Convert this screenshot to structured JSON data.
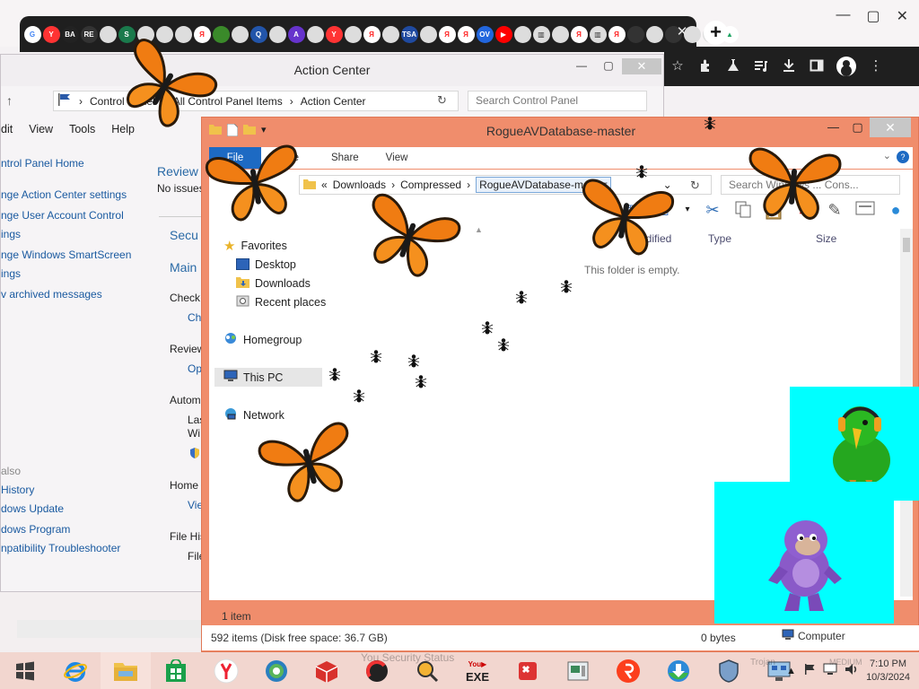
{
  "browser": {
    "favicons": [
      {
        "name": "google",
        "letter": "G",
        "color": "#ffffff",
        "fg": "#4285f4"
      },
      {
        "name": "yandex",
        "letter": "Y",
        "color": "#ff3333",
        "fg": "#ffffff"
      },
      {
        "name": "ba",
        "letter": "BA",
        "color": "#222222",
        "fg": "#ffffff"
      },
      {
        "name": "re",
        "letter": "RE",
        "color": "#333333",
        "fg": "#ffffff"
      },
      {
        "name": "globe",
        "letter": "",
        "color": "#dddddd",
        "fg": "#333"
      },
      {
        "name": "s",
        "letter": "S",
        "color": "#1a7a4c",
        "fg": "#ffffff"
      },
      {
        "name": "globe",
        "letter": "",
        "color": "#dddddd",
        "fg": "#333"
      },
      {
        "name": "globe",
        "letter": "",
        "color": "#dddddd",
        "fg": "#333"
      },
      {
        "name": "globe",
        "letter": "",
        "color": "#dddddd",
        "fg": "#333"
      },
      {
        "name": "ya",
        "letter": "Я",
        "color": "#ffffff",
        "fg": "#ff2222"
      },
      {
        "name": "leaf",
        "letter": "",
        "color": "#3a8a2a",
        "fg": "#fff"
      },
      {
        "name": "globe",
        "letter": "",
        "color": "#dddddd",
        "fg": "#333"
      },
      {
        "name": "q",
        "letter": "Q",
        "color": "#2255aa",
        "fg": "#ffffff"
      },
      {
        "name": "globe",
        "letter": "",
        "color": "#dddddd",
        "fg": "#333"
      },
      {
        "name": "avast",
        "letter": "A",
        "color": "#6633cc",
        "fg": "#ffffff"
      },
      {
        "name": "globe",
        "letter": "",
        "color": "#dddddd",
        "fg": "#333"
      },
      {
        "name": "y",
        "letter": "Y",
        "color": "#ff3333",
        "fg": "#ffffff"
      },
      {
        "name": "globe",
        "letter": "",
        "color": "#dddddd",
        "fg": "#333"
      },
      {
        "name": "ya",
        "letter": "Я",
        "color": "#ffffff",
        "fg": "#ff2222"
      },
      {
        "name": "globe",
        "letter": "",
        "color": "#dddddd",
        "fg": "#333"
      },
      {
        "name": "tsa",
        "letter": "TSA",
        "color": "#1f4aa0",
        "fg": "#ffffff"
      },
      {
        "name": "globe",
        "letter": "",
        "color": "#dddddd",
        "fg": "#333"
      },
      {
        "name": "ya",
        "letter": "Я",
        "color": "#ffffff",
        "fg": "#ff2222"
      },
      {
        "name": "ya",
        "letter": "Я",
        "color": "#ffffff",
        "fg": "#ff2222"
      },
      {
        "name": "ov",
        "letter": "OV",
        "color": "#2266dd",
        "fg": "#ffffff"
      },
      {
        "name": "youtube",
        "letter": "▶",
        "color": "#ff0000",
        "fg": "#ffffff"
      },
      {
        "name": "globe",
        "letter": "",
        "color": "#dddddd",
        "fg": "#333"
      },
      {
        "name": "bank",
        "letter": "▥",
        "color": "#dddddd",
        "fg": "#333"
      },
      {
        "name": "globe",
        "letter": "",
        "color": "#dddddd",
        "fg": "#333"
      },
      {
        "name": "ya",
        "letter": "Я",
        "color": "#ffffff",
        "fg": "#ff2222"
      },
      {
        "name": "bank",
        "letter": "▥",
        "color": "#dddddd",
        "fg": "#333"
      },
      {
        "name": "ya",
        "letter": "Я",
        "color": "#ffffff",
        "fg": "#ff2222"
      },
      {
        "name": "dark",
        "letter": "",
        "color": "#333333",
        "fg": "#fff"
      },
      {
        "name": "globe",
        "letter": "",
        "color": "#dddddd",
        "fg": "#333"
      },
      {
        "name": "dark",
        "letter": "",
        "color": "#333333",
        "fg": "#fff"
      },
      {
        "name": "globe",
        "letter": "",
        "color": "#dddddd",
        "fg": "#333"
      },
      {
        "name": "globe",
        "letter": "",
        "color": "#dddddd",
        "fg": "#333"
      },
      {
        "name": "drive",
        "letter": "▲",
        "color": "#ffffff",
        "fg": "#1fa463"
      }
    ],
    "tab_close": "✕",
    "new_tab": "+",
    "window_controls": {
      "minimize": "—",
      "maximize": "▢",
      "close": "✕"
    }
  },
  "action_center": {
    "title": "Action Center",
    "controls": {
      "minimize": "—",
      "maximize": "▢",
      "close": "✕"
    },
    "breadcrumb": [
      "Control Panel",
      "All Control Panel Items",
      "Action Center"
    ],
    "search_placeholder": "Search Control Panel",
    "menu": [
      "dit",
      "View",
      "Tools",
      "Help"
    ],
    "left_links": [
      "ntrol Panel Home",
      "nge Action Center settings",
      "nge User Account Control",
      "ings",
      "nge Windows SmartScreen",
      "ings",
      "v archived messages"
    ],
    "see_also_label": "also",
    "see_also": [
      "History",
      "dows Update",
      "dows Program",
      "npatibility Troubleshooter"
    ],
    "main_fragments": [
      "Review",
      "No issues",
      "Secu",
      "Main",
      "Check",
      "Ch",
      "Review",
      "Op",
      "Autom",
      "Las",
      "Wi",
      "Home",
      "Vie",
      "File His",
      "File"
    ]
  },
  "explorer": {
    "title": "RogueAVDatabase-master",
    "controls": {
      "minimize": "—",
      "maximize": "▢",
      "close": "✕"
    },
    "ribbon_tabs": {
      "file": "File",
      "home": "me",
      "share": "Share",
      "view": "View"
    },
    "breadcrumb": [
      "Downloads",
      "Compressed",
      "RogueAVDatabase-master"
    ],
    "breadcrumb_prefix": "«",
    "search_placeholder": "Search Windows ... Cons...",
    "columns": [
      "modified",
      "Type",
      "Size"
    ],
    "empty_text": "This folder is empty.",
    "nav": {
      "favorites": "Favorites",
      "desktop": "Desktop",
      "downloads": "Downloads",
      "recent": "Recent places",
      "homegroup": "Homegroup",
      "this_pc": "This PC",
      "network": "Network"
    },
    "item_count": "1 item",
    "status_left": "592 items (Disk free space: 36.7 GB)",
    "status_size": "0 bytes",
    "status_location": "Computer"
  },
  "taskbar": {
    "faded_labels": [
      "You Security Status",
      "Trojan",
      "MEDIUM"
    ],
    "clock_time": "7:10 PM",
    "clock_date": "10/3/2024",
    "exe_label": "EXE"
  }
}
